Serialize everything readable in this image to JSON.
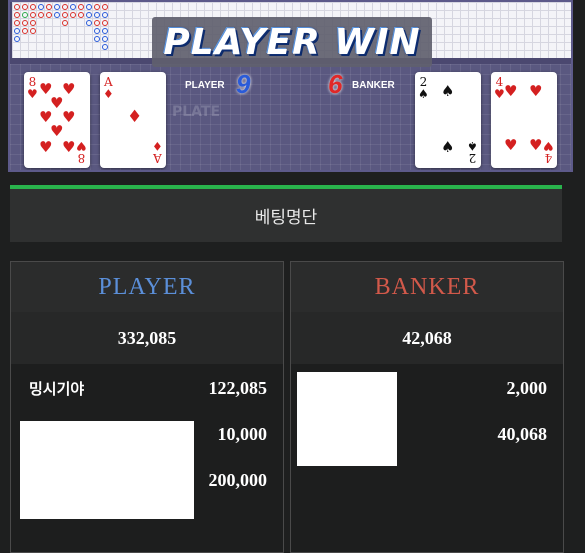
{
  "board": {
    "result_banner": "PLAYER WIN",
    "table_watermark": "PLATE",
    "player": {
      "label": "PLAYER",
      "score": "9",
      "cards": [
        {
          "rank": "8",
          "suit": "♥",
          "color": "red"
        },
        {
          "rank": "A",
          "suit": "♦",
          "color": "red"
        }
      ]
    },
    "banker": {
      "label": "BANKER",
      "score": "6",
      "cards": [
        {
          "rank": "2",
          "suit": "♠",
          "color": "black"
        },
        {
          "rank": "4",
          "suit": "♥",
          "color": "red"
        }
      ]
    }
  },
  "panel": {
    "title": "베팅명단",
    "player": {
      "header": "PLAYER",
      "total": "332,085",
      "bets": [
        {
          "name": "밍시기야",
          "amount": "122,085"
        },
        {
          "name": "",
          "amount": "10,000"
        },
        {
          "name": "",
          "amount": "200,000"
        }
      ]
    },
    "banker": {
      "header": "BANKER",
      "total": "42,068",
      "bets": [
        {
          "name": "",
          "amount": "2,000"
        },
        {
          "name": "",
          "amount": "40,068"
        }
      ]
    }
  },
  "colors": {
    "player": "#5b8fd9",
    "banker": "#d2594a",
    "accent_green": "#29b34c",
    "player_score": "#2a5bd8",
    "banker_score": "#e02828"
  }
}
